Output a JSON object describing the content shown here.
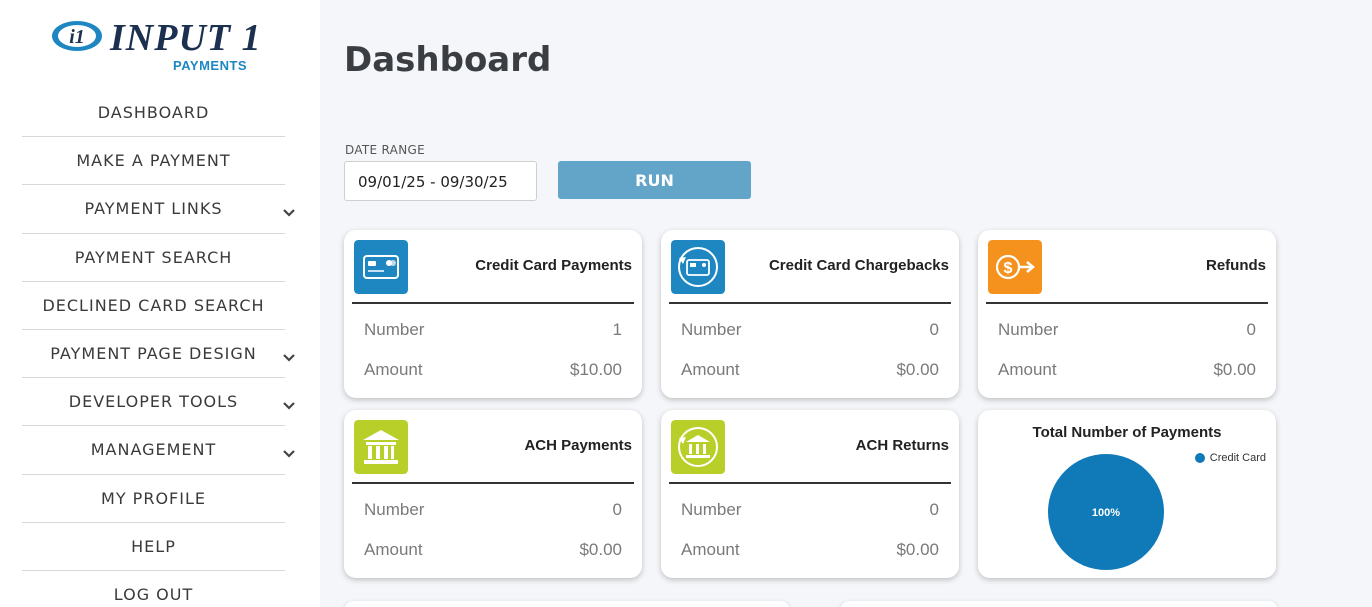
{
  "logo": {
    "name": "INPUT 1",
    "sub": "PAYMENTS",
    "badge": "i1"
  },
  "sidebar": {
    "items": [
      {
        "label": "DASHBOARD",
        "chevron": false
      },
      {
        "label": "MAKE A PAYMENT",
        "chevron": false
      },
      {
        "label": "PAYMENT LINKS",
        "chevron": true
      },
      {
        "label": "PAYMENT SEARCH",
        "chevron": false
      },
      {
        "label": "DECLINED CARD SEARCH",
        "chevron": false
      },
      {
        "label": "PAYMENT PAGE DESIGN",
        "chevron": true
      },
      {
        "label": "DEVELOPER TOOLS",
        "chevron": true
      },
      {
        "label": "MANAGEMENT",
        "chevron": true
      },
      {
        "label": "MY PROFILE",
        "chevron": false
      },
      {
        "label": "HELP",
        "chevron": false
      },
      {
        "label": "LOG OUT",
        "chevron": false
      }
    ]
  },
  "main": {
    "title": "Dashboard",
    "date_range": {
      "label": "DATE RANGE",
      "value": "09/01/25 - 09/30/25"
    },
    "run_label": "RUN",
    "cards": [
      {
        "title": "Credit Card Payments",
        "icon": "credit-card-icon",
        "icon_color": "#1e87c2",
        "number_label": "Number",
        "number": "1",
        "amount_label": "Amount",
        "amount": "$10.00"
      },
      {
        "title": "Credit Card Chargebacks",
        "icon": "chargeback-icon",
        "icon_color": "#1e87c2",
        "number_label": "Number",
        "number": "0",
        "amount_label": "Amount",
        "amount": "$0.00"
      },
      {
        "title": "Refunds",
        "icon": "refund-icon",
        "icon_color": "#f5921e",
        "number_label": "Number",
        "number": "0",
        "amount_label": "Amount",
        "amount": "$0.00"
      },
      {
        "title": "ACH Payments",
        "icon": "bank-icon",
        "icon_color": "#b9cf29",
        "number_label": "Number",
        "number": "0",
        "amount_label": "Amount",
        "amount": "$0.00"
      },
      {
        "title": "ACH Returns",
        "icon": "bank-return-icon",
        "icon_color": "#b9cf29",
        "number_label": "Number",
        "number": "0",
        "amount_label": "Amount",
        "amount": "$0.00"
      }
    ],
    "pie": {
      "title": "Total Number of Payments",
      "legend": "Credit Card",
      "label": "100%",
      "color": "#0f7ab7"
    }
  },
  "chart_data": {
    "type": "pie",
    "title": "Total Number of Payments",
    "categories": [
      "Credit Card"
    ],
    "values": [
      100
    ],
    "legend_position": "top-right"
  }
}
